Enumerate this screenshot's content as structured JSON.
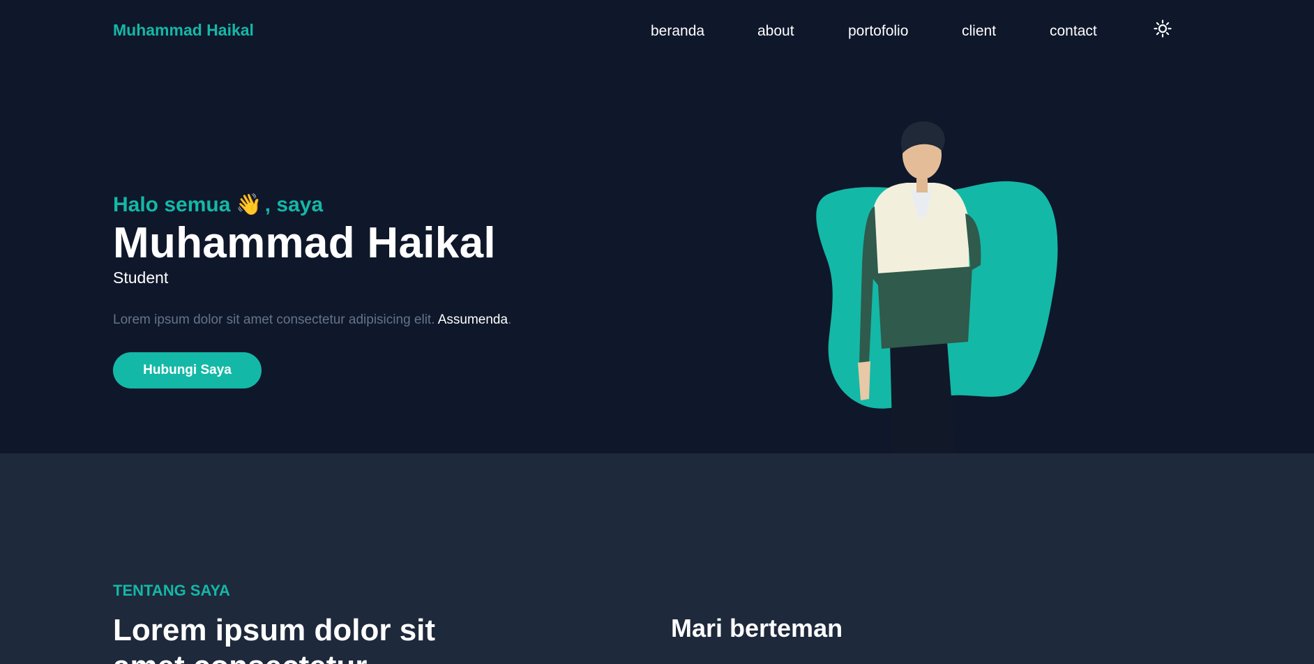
{
  "navbar": {
    "brand": "Muhammad Haikal",
    "links": [
      "beranda",
      "about",
      "portofolio",
      "client",
      "contact"
    ],
    "theme_toggle_icon": "sun-icon"
  },
  "hero": {
    "greeting_before": "Halo semua",
    "greeting_emoji": "👋",
    "greeting_after": ", saya",
    "name": "Muhammad Haikal",
    "role": "Student",
    "description": "Lorem ipsum dolor sit amet consectetur adipisicing elit.",
    "description_highlight": "Assumenda",
    "description_end": ".",
    "cta_label": "Hubungi Saya"
  },
  "about": {
    "eyebrow": "TENTANG SAYA",
    "title": "Lorem ipsum dolor sit amet consectetur",
    "side_title": "Mari berteman"
  },
  "colors": {
    "background": "#0f172a",
    "section_alt": "#1e293b",
    "accent": "#14b8a6",
    "muted_text": "#64748b",
    "text": "#ffffff"
  }
}
